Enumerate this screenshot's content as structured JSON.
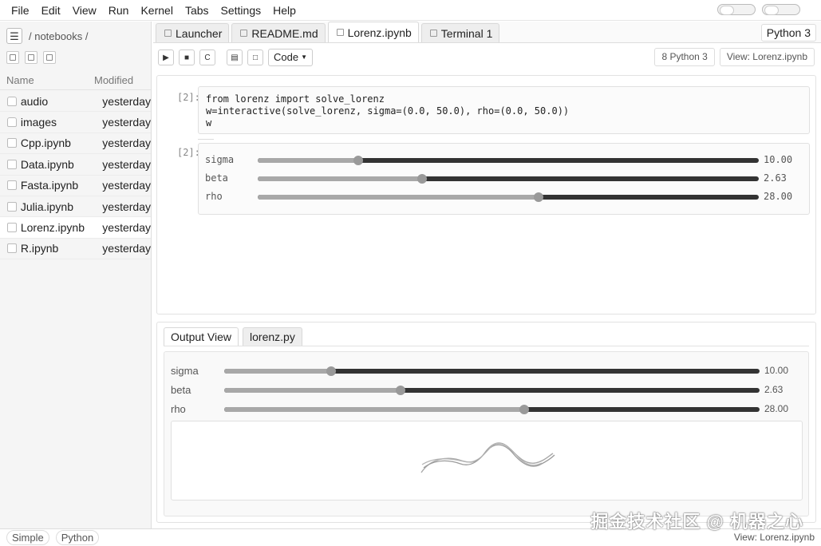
{
  "menu": [
    "File",
    "Edit",
    "View",
    "Run",
    "Kernel",
    "Tabs",
    "Settings",
    "Help"
  ],
  "left_panel": {
    "path": "/ notebooks /",
    "col_name": "Name",
    "col_modified": "Modified",
    "files": [
      {
        "name": "audio",
        "modified": "yesterday",
        "kind": "folder"
      },
      {
        "name": "images",
        "modified": "yesterday",
        "kind": "folder"
      },
      {
        "name": "Cpp.ipynb",
        "modified": "yesterday",
        "kind": "notebook"
      },
      {
        "name": "Data.ipynb",
        "modified": "yesterday",
        "kind": "notebook"
      },
      {
        "name": "Fasta.ipynb",
        "modified": "yesterday",
        "kind": "notebook"
      },
      {
        "name": "Julia.ipynb",
        "modified": "yesterday",
        "kind": "notebook"
      },
      {
        "name": "Lorenz.ipynb",
        "modified": "yesterday",
        "kind": "notebook",
        "active": true
      },
      {
        "name": "R.ipynb",
        "modified": "yesterday",
        "kind": "notebook"
      }
    ]
  },
  "tabs": [
    {
      "label": "Launcher"
    },
    {
      "label": "README.md"
    },
    {
      "label": "Lorenz.ipynb",
      "active": true
    },
    {
      "label": "Terminal 1"
    }
  ],
  "kernel_badge": "Python 3",
  "toolbar": {
    "cell_type": "Code",
    "restart_label": "C",
    "kernel_status": "8 Python 3",
    "view_label": "View: Lorenz.ipynb"
  },
  "cells": {
    "code_prompt": "[2]:",
    "code_lines": [
      "from lorenz import solve_lorenz",
      "w=interactive(solve_lorenz, sigma=(0.0, 50.0), rho=(0.0, 50.0))",
      "w"
    ],
    "output_prompt": "[2]:"
  },
  "sliders": [
    {
      "label": "sigma",
      "value": 10.0,
      "display": "10.00",
      "min": 0,
      "max": 50
    },
    {
      "label": "beta",
      "value": 2.63,
      "display": "2.63",
      "min": 0,
      "max": 8
    },
    {
      "label": "rho",
      "value": 28.0,
      "display": "28.00",
      "min": 0,
      "max": 50
    }
  ],
  "output_view": {
    "tabs": [
      {
        "label": "Output View",
        "active": true
      },
      {
        "label": "lorenz.py"
      }
    ]
  },
  "status": {
    "mode": "Simple",
    "language": "Python",
    "right": "View: Lorenz.ipynb"
  },
  "watermark": "掘金技术社区 @ 机器之心",
  "colors": {
    "slider_track": "#333333",
    "slider_fill": "#a8a8a8",
    "slider_thumb": "#999999"
  }
}
